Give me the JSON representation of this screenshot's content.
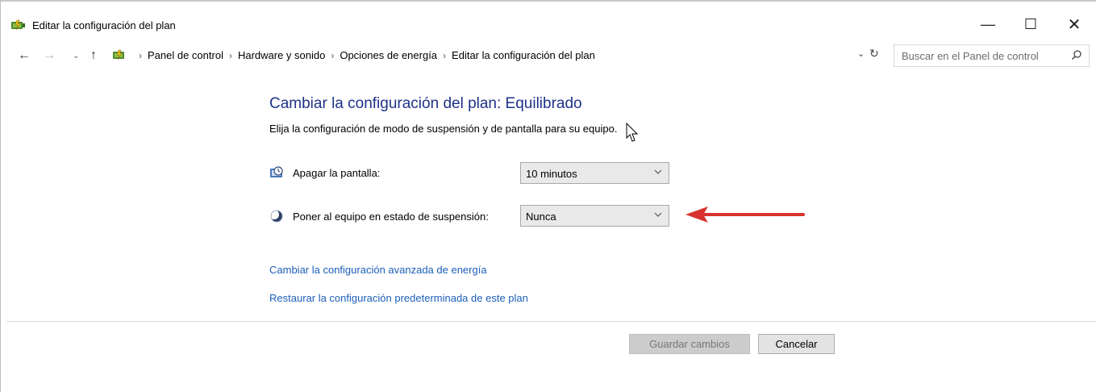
{
  "window": {
    "title": "Editar la configuración del plan",
    "app_icon": "power-options-icon",
    "controls": {
      "minimize": "—",
      "maximize": "☐",
      "close": "✕"
    }
  },
  "address": {
    "crumb_icon": "control-panel-icon",
    "crumbs": [
      "Panel de control",
      "Hardware y sonido",
      "Opciones de energía",
      "Editar la configuración del plan"
    ],
    "separator": "›"
  },
  "search": {
    "placeholder": "Buscar en el Panel de control"
  },
  "main": {
    "heading": "Cambiar la configuración del plan: Equilibrado",
    "subheading": "Elija la configuración de modo de suspensión y de pantalla para su equipo.",
    "settings": [
      {
        "label": "Apagar la pantalla:",
        "value": "10 minutos",
        "icon": "display-timer-icon"
      },
      {
        "label": "Poner al equipo en estado de suspensión:",
        "value": "Nunca",
        "icon": "sleep-moon-icon"
      }
    ],
    "links": [
      "Cambiar la configuración avanzada de energía",
      "Restaurar la configuración predeterminada de este plan"
    ]
  },
  "footer": {
    "save_label": "Guardar cambios",
    "cancel_label": "Cancelar"
  },
  "colors": {
    "heading": "#1e3287",
    "link": "#1c5fb8",
    "annotation_arrow": "#d9322e"
  }
}
